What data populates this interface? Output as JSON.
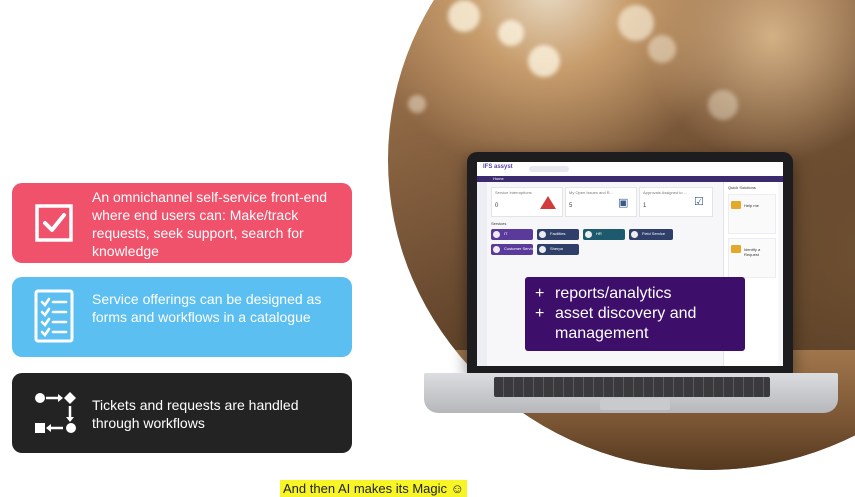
{
  "features": [
    {
      "text": "An omnichannel self-service front-end where end users can: Make/track requests, seek support, search for knowledge",
      "color": "#f0516b",
      "icon": "checkbox-icon"
    },
    {
      "text": "Service offerings can be designed as forms and workflows in a catalogue",
      "color": "#5bbff2",
      "icon": "checklist-icon"
    },
    {
      "text": "Tickets and requests are handled through workflows",
      "color": "#232323",
      "icon": "workflow-icon"
    }
  ],
  "addons": {
    "items": [
      "reports/analytics",
      "asset discovery and"
    ],
    "continuation": "management",
    "prefix": "+",
    "bg_color": "#3d0f6b"
  },
  "caption": {
    "text": "And then AI makes its Magic ☺",
    "highlight": "#f7f526"
  },
  "app_screen": {
    "brand": "IFS assyst",
    "nav_label": "Home",
    "cards": [
      {
        "label": "Service Interruptions",
        "value": "0"
      },
      {
        "label": "My Open Issues and R...",
        "value": "5"
      },
      {
        "label": "Approvals Assigned to ...",
        "value": "1"
      }
    ],
    "section_label": "Services",
    "tiles": [
      "IT",
      "Facilities",
      "HR",
      "Field Service",
      "Customer Service",
      "Sherpa"
    ],
    "side_title": "Quick Solutions",
    "side_items": [
      "Help me",
      "Identify a Request"
    ]
  }
}
